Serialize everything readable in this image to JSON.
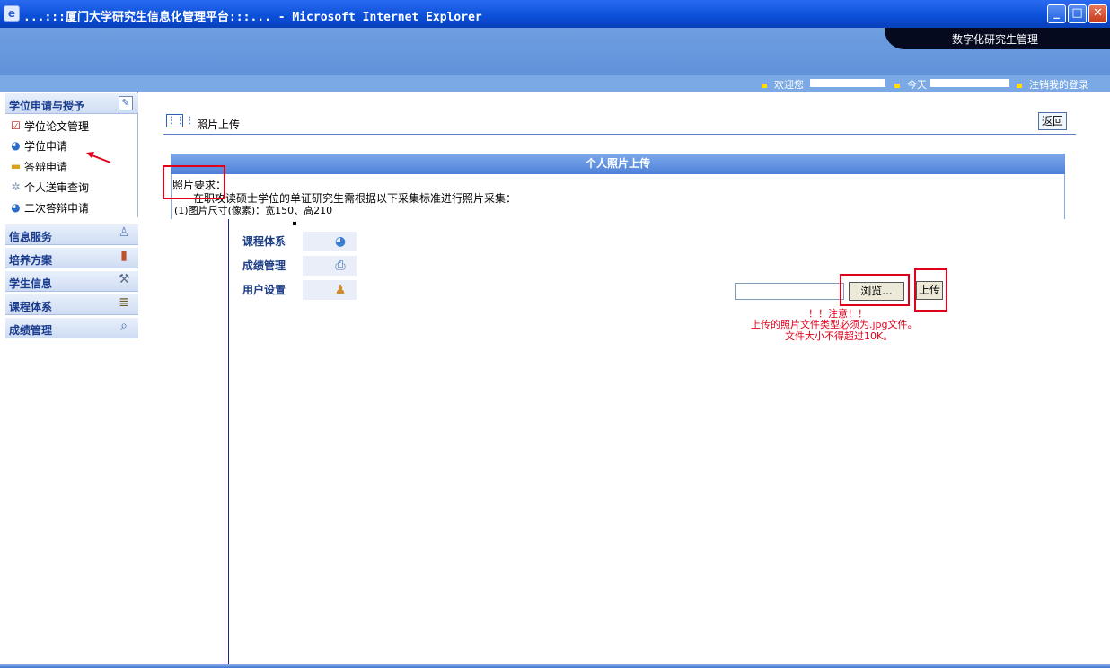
{
  "window": {
    "title": "...:::厦门大学研究生信息化管理平台:::... - Microsoft Internet Explorer",
    "ie_icon": "ie-page-icon"
  },
  "header": {
    "brand": "数字化研究生管理",
    "welcome": "欢迎您",
    "today": "今天",
    "logout": "注销我的登录"
  },
  "sidebar": {
    "section_degree": {
      "label": "学位申请与授予",
      "items": [
        {
          "label": "学位论文管理",
          "icon": "checklist-icon"
        },
        {
          "label": "学位申请",
          "icon": "globe-icon"
        },
        {
          "label": "答辩申请",
          "icon": "folder-icon"
        },
        {
          "label": "个人送审查询",
          "icon": "gear-icon"
        },
        {
          "label": "二次答辩申请",
          "icon": "globe-icon"
        }
      ]
    },
    "sections": [
      {
        "label": "信息服务",
        "icon": "person-icon"
      },
      {
        "label": "培养方案",
        "icon": "book-icon"
      },
      {
        "label": "学生信息",
        "icon": "tools-icon"
      },
      {
        "label": "课程体系",
        "icon": "books-icon"
      },
      {
        "label": "成绩管理",
        "icon": "magnifier-icon"
      }
    ]
  },
  "main": {
    "page_title": "照片上传",
    "back_label": "返回",
    "panel_title": "个人照片上传",
    "req_title": "照片要求：",
    "req_line": "在职攻读硕士学位的单证研究生需根据以下采集标准进行照片采集：",
    "req_size": "(1)图片尺寸(像素)：宽150、高210"
  },
  "overlay_menu": [
    {
      "label": "课程体系",
      "icon": "globe-icon"
    },
    {
      "label": "成绩管理",
      "icon": "network-icon"
    },
    {
      "label": "用户设置",
      "icon": "users-icon"
    }
  ],
  "upload": {
    "file_value": "",
    "browse_label": "浏览...",
    "upload_label": "上传",
    "notice_title": "！！注意！！",
    "notice_type": "上传的照片文件类型必须为.jpg文件。",
    "notice_size": "文件大小不得超过10K。"
  }
}
